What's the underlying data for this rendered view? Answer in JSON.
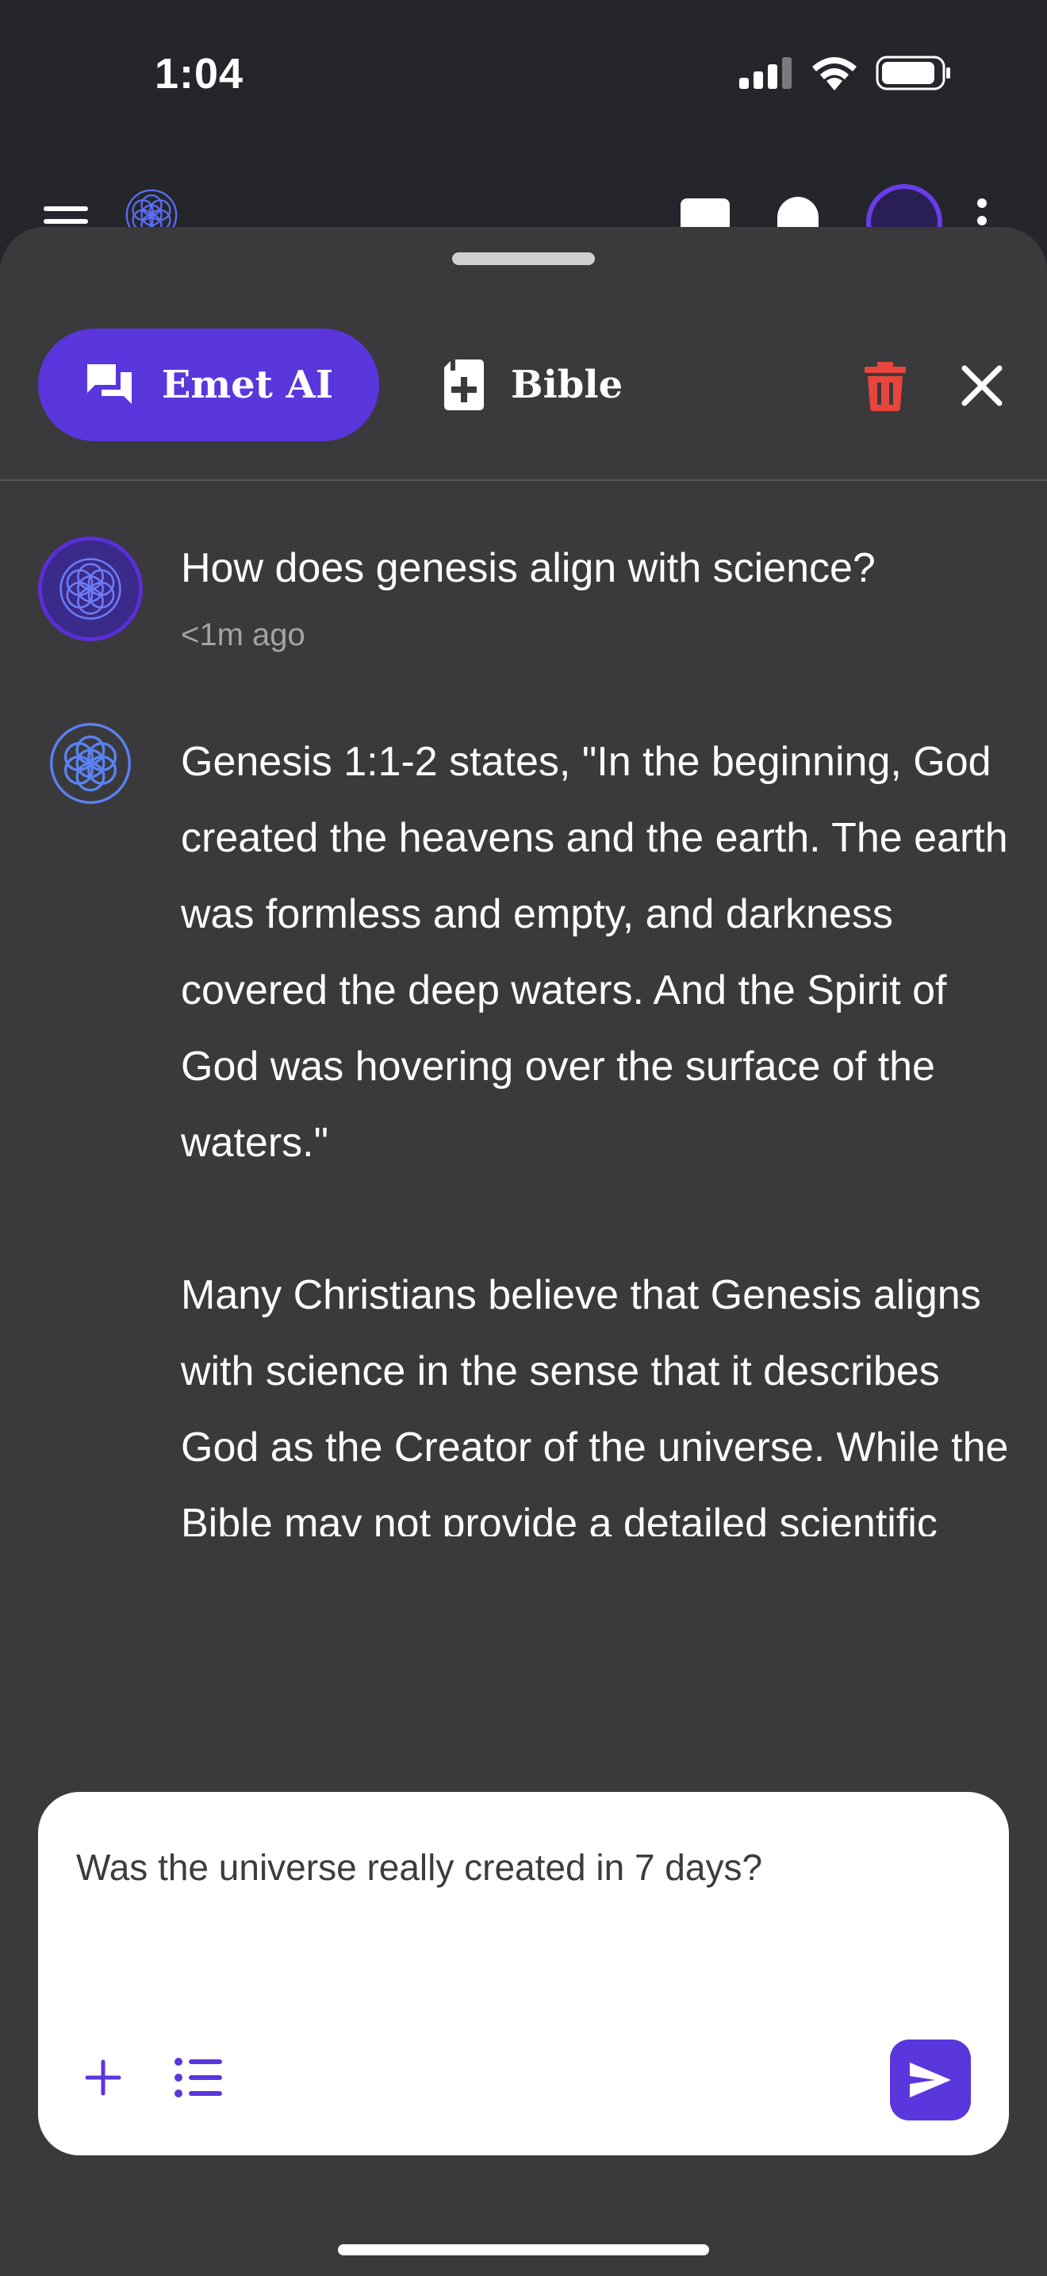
{
  "status_bar": {
    "time": "1:04"
  },
  "colors": {
    "accent": "#5a36dd",
    "sheet_bg": "#3a3a3c",
    "danger": "#e8453c"
  },
  "tabs": [
    {
      "label": "Emet AI",
      "icon": "chat-icon",
      "active": true
    },
    {
      "label": "Bible",
      "icon": "bible-plus-icon",
      "active": false
    }
  ],
  "chat": {
    "user_message": "How does genesis align with science?",
    "user_time": "<1m ago",
    "ai_message": "Genesis 1:1-2 states, \"In the beginning, God created the heavens and the earth. The earth was formless and empty, and darkness covered the deep waters. And the Spirit of God was hovering over the surface of the waters.\"\n\nMany Christians believe that Genesis aligns with science in the sense that it describes God as the Creator of the universe. While the Bible may not provide a detailed scientific explanation of how God created the world, it does affirm that God is the ultimate source of all creation."
  },
  "composer": {
    "value": "Was the universe really created in 7 days?"
  }
}
